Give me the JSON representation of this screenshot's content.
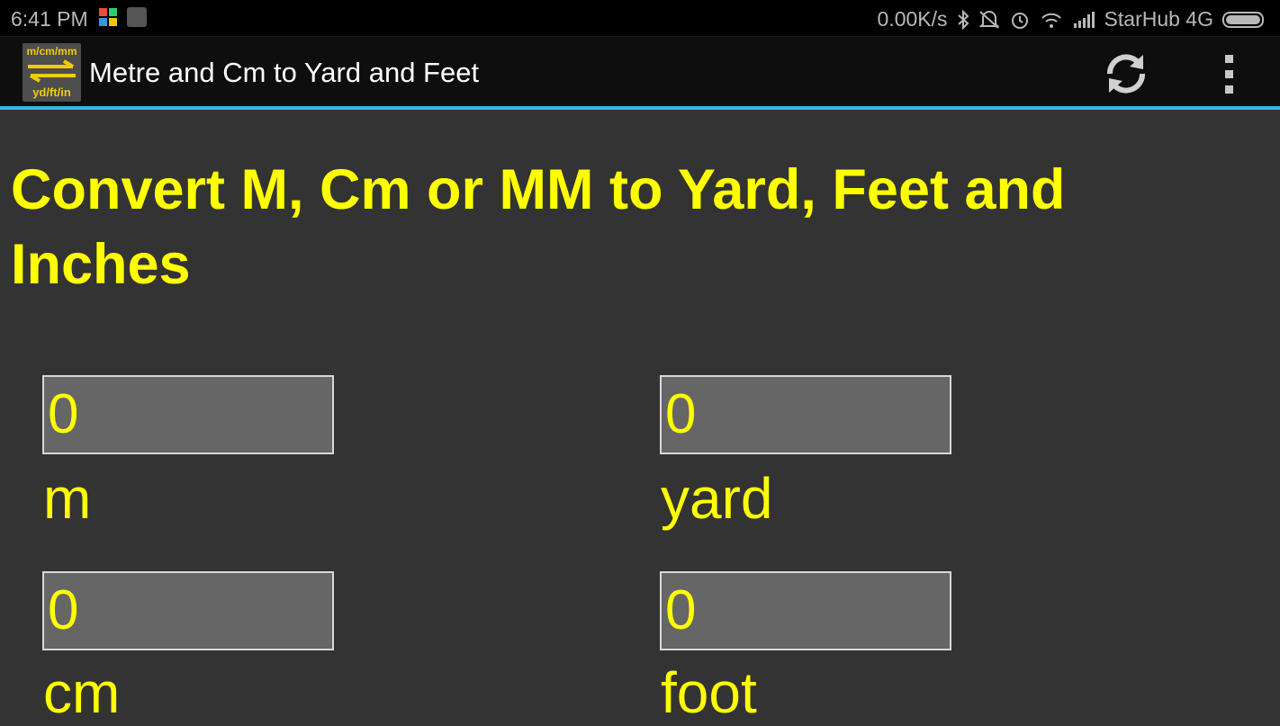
{
  "status_bar": {
    "time": "6:41 PM",
    "speed": "0.00K/s",
    "carrier": "StarHub 4G"
  },
  "action_bar": {
    "app_icon_top": "m/cm/mm",
    "app_icon_bottom": "yd/ft/in",
    "title": "Metre and Cm to Yard and Feet"
  },
  "main": {
    "heading": "Convert M, Cm or MM to Yard, Feet and Inches",
    "fields": {
      "m": {
        "value": "0",
        "label": "m"
      },
      "yard": {
        "value": "0",
        "label": "yard"
      },
      "cm": {
        "value": "0",
        "label": "cm"
      },
      "foot": {
        "value": "0",
        "label": "foot"
      }
    }
  },
  "colors": {
    "accent": "#ffff00",
    "action_bar_divider": "#33b5e5",
    "background": "#333333"
  }
}
